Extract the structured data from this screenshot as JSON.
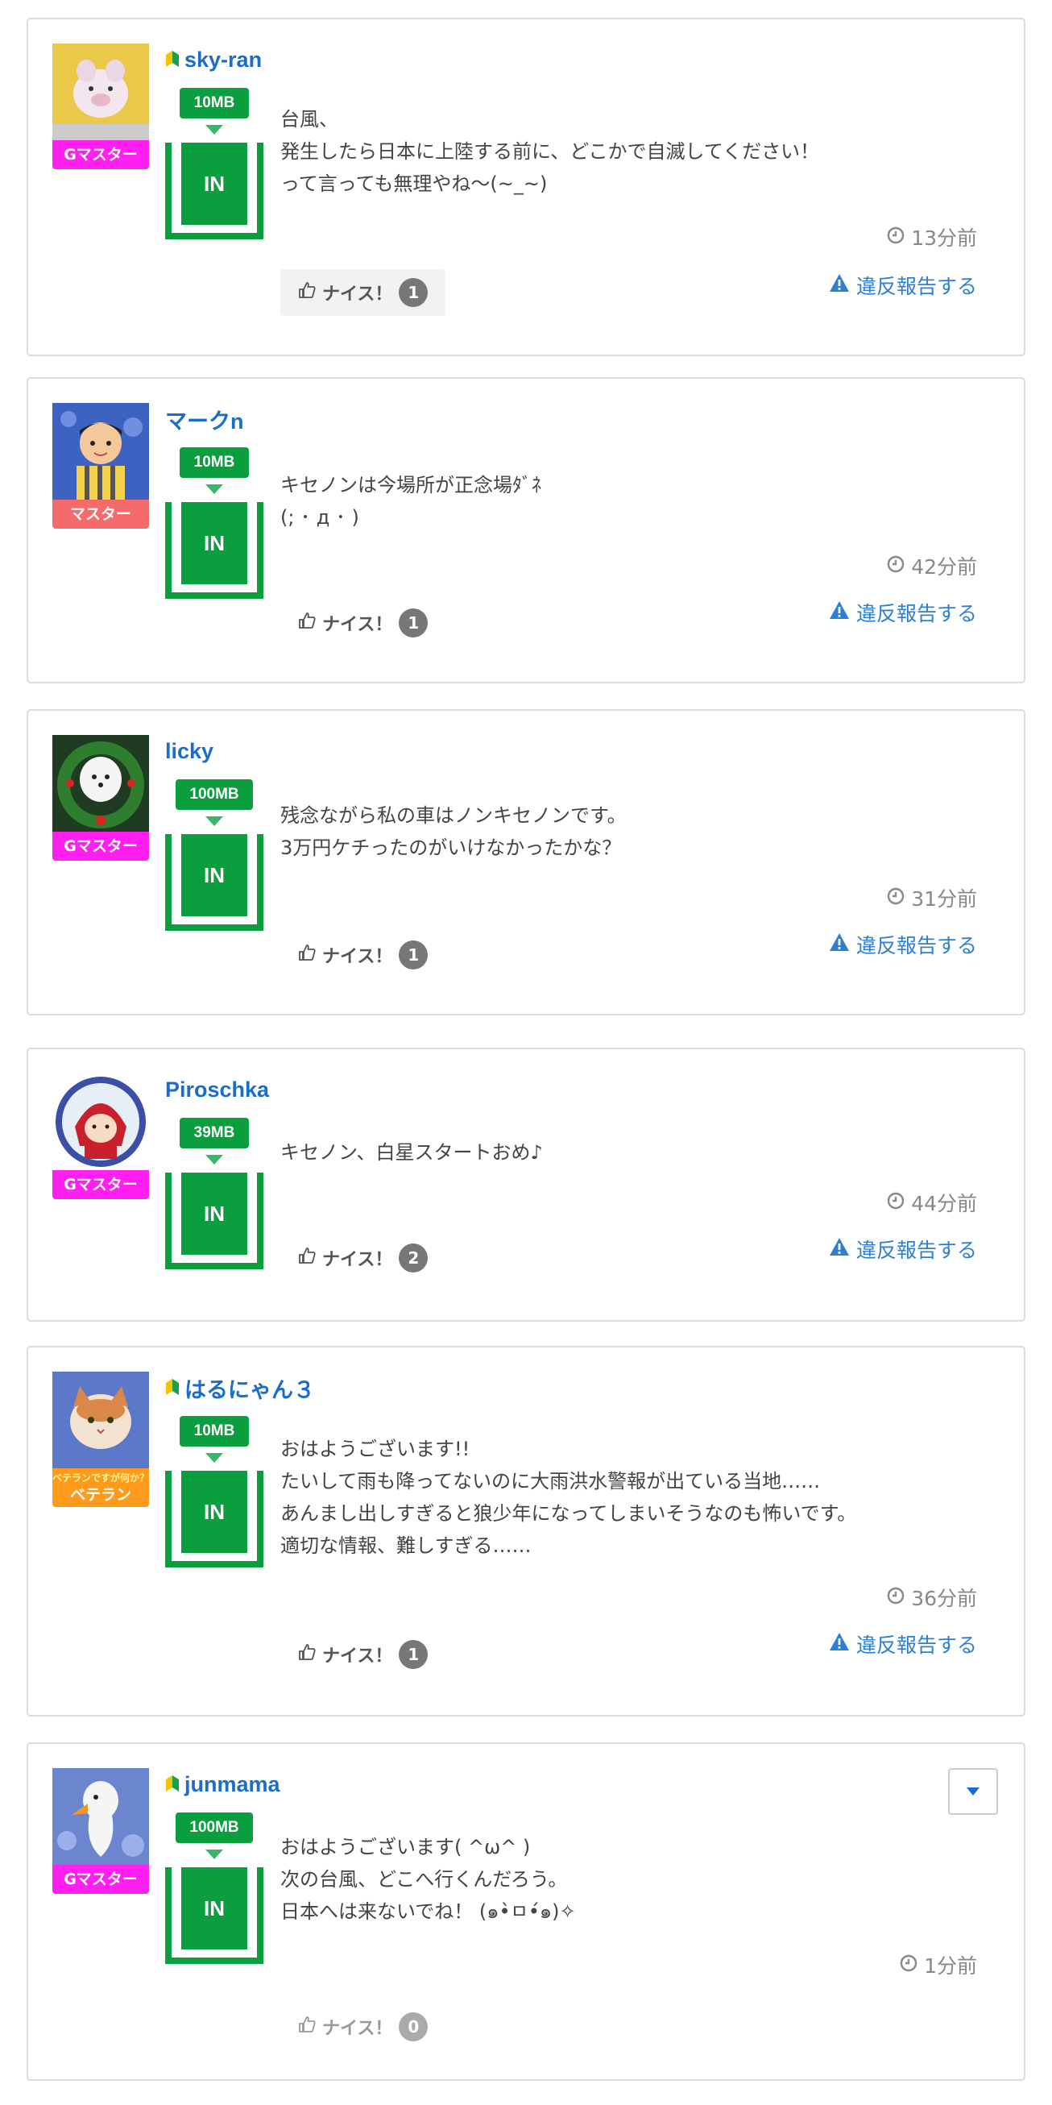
{
  "colors": {
    "accent_link": "#1a6dc9",
    "meter_green": "#0a9e3f",
    "master_red": "#f56a6a",
    "gmaster_magenta": "#ff1ff0",
    "veteran_orange": "#ff9a1a"
  },
  "ui": {
    "nice_label": "ナイス！",
    "report_label": "違反報告する",
    "in_label": "IN"
  },
  "posts": [
    {
      "username": "sky-ran",
      "beginner_mark": true,
      "rank": "Gマスター",
      "mb": "10MB",
      "lines": [
        "台風、",
        "発生したら日本に上陸する前に、どこかで自滅してください！",
        "って言っても無理やね〜(~_~)"
      ],
      "time": "13分前",
      "nice": "1",
      "icon": "clock-icon"
    },
    {
      "username": "マークn",
      "beginner_mark": false,
      "rank": "マスター",
      "mb": "10MB",
      "lines": [
        "キセノンは今場所が正念場ﾀﾞﾈ",
        "(; ･ д ･ )"
      ],
      "time": "42分前",
      "nice": "1",
      "icon": "clock-icon"
    },
    {
      "username": "licky",
      "beginner_mark": false,
      "rank": "Gマスター",
      "mb": "100MB",
      "lines": [
        "残念ながら私の車はノンキセノンです。",
        "3万円ケチったのがいけなかったかな？"
      ],
      "time": "31分前",
      "nice": "1",
      "icon": "clock-icon"
    },
    {
      "username": "Piroschka",
      "beginner_mark": false,
      "rank": "Gマスター",
      "mb": "39MB",
      "lines": [
        "キセノン、白星スタートおめ♪"
      ],
      "time": "44分前",
      "nice": "2",
      "icon": "clock-icon"
    },
    {
      "username": "はるにゃん３",
      "beginner_mark": true,
      "rank": "ベテラン",
      "avatar_caption": "ベテランですが何か？",
      "mb": "10MB",
      "lines": [
        "おはようございます!!",
        "たいして雨も降ってないのに大雨洪水警報が出ている当地……",
        "あんまし出しすぎると狼少年になってしまいそうなのも怖いです。",
        "適切な情報、難しすぎる……"
      ],
      "time": "36分前",
      "nice": "1",
      "icon": "clock-icon"
    },
    {
      "username": "junmama",
      "beginner_mark": true,
      "rank": "Gマスター",
      "mb": "100MB",
      "lines": [
        "おはようございます( ^ω^ )",
        "次の台風、どこへ行くんだろう。",
        "日本へは来ないでね！ (๑•̀ㅁ•́๑)✧"
      ],
      "time": "1分前",
      "nice": "0",
      "icon": "clock-icon"
    }
  ]
}
